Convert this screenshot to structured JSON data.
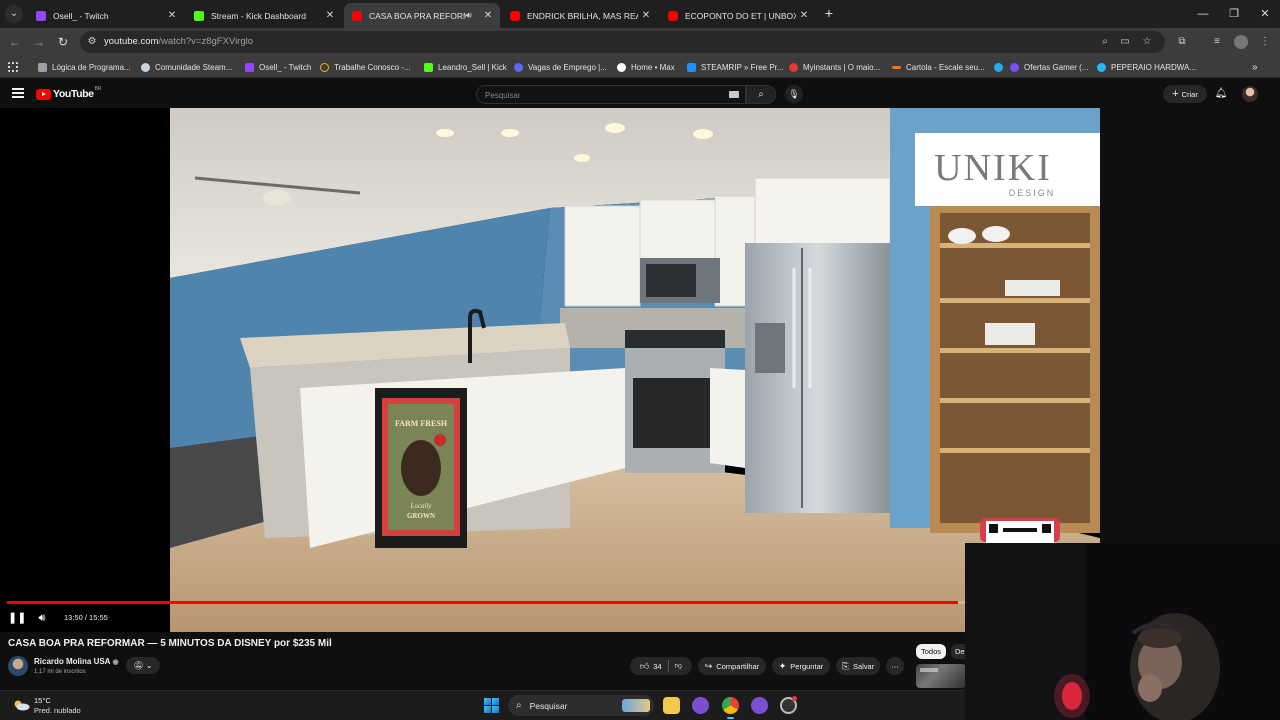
{
  "browser": {
    "tabs": [
      {
        "title": "Osell_ - Twitch",
        "favicon": "twitch-icon",
        "color": "#9146ff",
        "active": false
      },
      {
        "title": "Stream - Kick Dashboard",
        "favicon": "kick-icon",
        "color": "#53fc18",
        "active": false
      },
      {
        "title": "CASA BOA PRA REFORMAR",
        "favicon": "youtube-icon",
        "color": "#ff0000",
        "active": true,
        "audio": true
      },
      {
        "title": "ENDRICK BRILHA, MAS REAL M",
        "favicon": "youtube-icon",
        "color": "#ff0000",
        "active": false
      },
      {
        "title": "ECOPONTO DO ET | UNBOXING",
        "favicon": "youtube-icon",
        "color": "#ff0000",
        "active": false
      }
    ],
    "url_host": "youtube.com",
    "url_path": "/watch?v=z8gFXVirglo",
    "bookmarks": [
      {
        "label": "Lógica de Programa...",
        "color": "#9aa0a6"
      },
      {
        "label": "Comunidade Steam...",
        "color": "#c7d5e0"
      },
      {
        "label": "Osell_ - Twitch",
        "color": "#9146ff"
      },
      {
        "label": "Trabalhe Conosco -...",
        "color": "#f2b705"
      },
      {
        "label": "Leandro_Sell | Kick",
        "color": "#53fc18"
      },
      {
        "label": "Vagas de Emprego |...",
        "color": "#5b6cf0"
      },
      {
        "label": "Home • Max",
        "color": "#ffffff"
      },
      {
        "label": "STEAMRIP » Free Pr...",
        "color": "#1e90ff"
      },
      {
        "label": "Myinstants | O maio...",
        "color": "#e53935"
      },
      {
        "label": "Cartola - Escale seu...",
        "color": "#f57c00"
      },
      {
        "label": "",
        "color": "#29a9eb"
      },
      {
        "label": "Ofertas Gamer (...",
        "color": "#7c4dff"
      },
      {
        "label": "PEPERAIO HARDWA...",
        "color": "#29b6f6"
      }
    ]
  },
  "youtube": {
    "logo": "YouTube",
    "country": "BR",
    "search_placeholder": "Pesquisar",
    "create_label": "Criar"
  },
  "player": {
    "time": "13:50 / 15:55",
    "progress": 0.87,
    "brand_name": "UNIKI",
    "brand_sub": "DESIGN",
    "sign_line1": "FARM FRESH",
    "sign_line2": "Locally",
    "sign_line3": "GROWN"
  },
  "video": {
    "title": "CASA BOA PRA REFORMAR — 5 MINUTOS DA DISNEY por $235 Mil",
    "channel": "Ricardo Molina USA",
    "subscribers": "1,17 mi de inscritos",
    "likes": "34",
    "share_label": "Compartilhar",
    "ask_label": "Perguntar",
    "save_label": "Salvar"
  },
  "chips": {
    "all": "Todos",
    "next": "De"
  },
  "taskbar": {
    "temperature": "15°C",
    "condition": "Pred. nublado",
    "search_placeholder": "Pesquisar"
  },
  "colors": {
    "accent": "#ff0000",
    "background": "#0f0f0f",
    "wall": "#5b8db3"
  }
}
